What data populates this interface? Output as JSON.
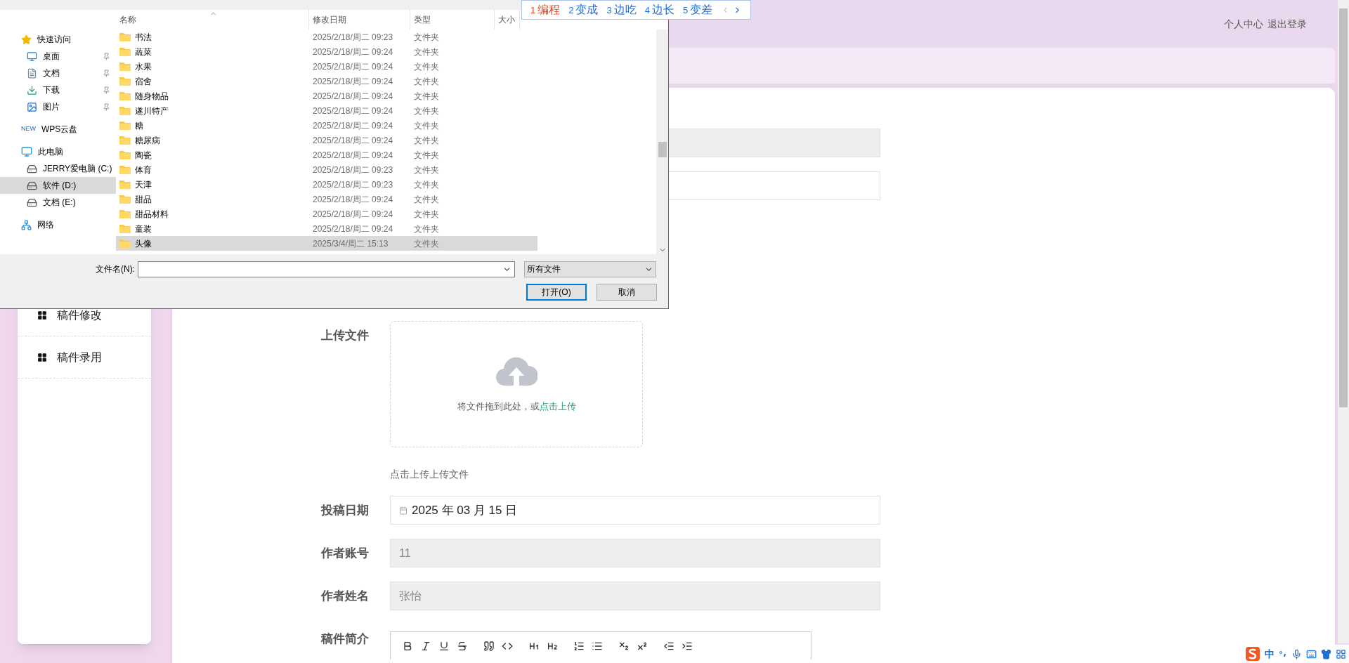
{
  "ime_candidates": [
    {
      "index": "1",
      "word": "编程",
      "selected": true
    },
    {
      "index": "2",
      "word": "变成",
      "selected": false
    },
    {
      "index": "3",
      "word": "边吃",
      "selected": false
    },
    {
      "index": "4",
      "word": "边长",
      "selected": false
    },
    {
      "index": "5",
      "word": "变差",
      "selected": false
    }
  ],
  "header": {
    "links": [
      "个人中心",
      "退出登录"
    ]
  },
  "sidebar": {
    "items": [
      {
        "label": "稿件修改"
      },
      {
        "label": "稿件录用"
      }
    ]
  },
  "form": {
    "fields": [
      {
        "kind": "readonly"
      },
      {
        "kind": "text"
      },
      {
        "kind": "upload",
        "label": "上传文件",
        "prompt": "将文件拖到此处，或",
        "link": "点击上传",
        "hint": "点击上传上传文件"
      },
      {
        "kind": "date",
        "label": "投稿日期",
        "value": "2025 年 03 月 15 日"
      },
      {
        "kind": "readonly",
        "label": "作者账号",
        "value": "11"
      },
      {
        "kind": "readonly",
        "label": "作者姓名",
        "value": "张怡"
      },
      {
        "kind": "editor",
        "label": "稿件简介"
      }
    ]
  },
  "file_dialog": {
    "nav": [
      {
        "label": "快速访问",
        "kind": "star",
        "selected": false,
        "children": [
          {
            "label": "桌面",
            "kind": "desktop",
            "pinned": true,
            "selected": false
          },
          {
            "label": "文档",
            "kind": "document",
            "pinned": true,
            "selected": false
          },
          {
            "label": "下载",
            "kind": "download",
            "pinned": true,
            "selected": false
          },
          {
            "label": "图片",
            "kind": "picture",
            "pinned": true,
            "selected": false
          }
        ]
      },
      {
        "label": "WPS云盘",
        "badge": "NEW",
        "kind": "cloud",
        "selected": false
      },
      {
        "label": "此电脑",
        "kind": "computer",
        "selected": false,
        "children": [
          {
            "label": "JERRY爱电脑 (C:)",
            "kind": "system-drive",
            "pinned": false,
            "selected": false
          },
          {
            "label": "软件 (D:)",
            "kind": "drive",
            "pinned": false,
            "selected": true
          },
          {
            "label": "文档 (E:)",
            "kind": "drive",
            "pinned": false,
            "selected": false
          }
        ]
      },
      {
        "label": "网络",
        "kind": "network",
        "selected": false
      }
    ],
    "columns": [
      "名称",
      "修改日期",
      "类型",
      "大小"
    ],
    "rows": [
      {
        "name": "书法",
        "modified": "2025/2/18/周二 09:23",
        "type": "文件夹",
        "selected": false
      },
      {
        "name": "蔬菜",
        "modified": "2025/2/18/周二 09:24",
        "type": "文件夹",
        "selected": false
      },
      {
        "name": "水果",
        "modified": "2025/2/18/周二 09:24",
        "type": "文件夹",
        "selected": false
      },
      {
        "name": "宿舍",
        "modified": "2025/2/18/周二 09:24",
        "type": "文件夹",
        "selected": false
      },
      {
        "name": "随身物品",
        "modified": "2025/2/18/周二 09:24",
        "type": "文件夹",
        "selected": false
      },
      {
        "name": "遂川特产",
        "modified": "2025/2/18/周二 09:24",
        "type": "文件夹",
        "selected": false
      },
      {
        "name": "糖",
        "modified": "2025/2/18/周二 09:24",
        "type": "文件夹",
        "selected": false
      },
      {
        "name": "糖尿病",
        "modified": "2025/2/18/周二 09:24",
        "type": "文件夹",
        "selected": false
      },
      {
        "name": "陶瓷",
        "modified": "2025/2/18/周二 09:24",
        "type": "文件夹",
        "selected": false
      },
      {
        "name": "体育",
        "modified": "2025/2/18/周二 09:23",
        "type": "文件夹",
        "selected": false
      },
      {
        "name": "天津",
        "modified": "2025/2/18/周二 09:23",
        "type": "文件夹",
        "selected": false
      },
      {
        "name": "甜品",
        "modified": "2025/2/18/周二 09:24",
        "type": "文件夹",
        "selected": false
      },
      {
        "name": "甜品材料",
        "modified": "2025/2/18/周二 09:24",
        "type": "文件夹",
        "selected": false
      },
      {
        "name": "童装",
        "modified": "2025/2/18/周二 09:24",
        "type": "文件夹",
        "selected": false
      },
      {
        "name": "头像",
        "modified": "2025/3/4/周二 15:13",
        "type": "文件夹",
        "selected": true
      }
    ],
    "filename_label": "文件名(N):",
    "filter": "所有文件",
    "buttons": [
      {
        "label": "打开(O)",
        "default": true
      },
      {
        "label": "取消",
        "default": false
      }
    ]
  },
  "ime_status": {
    "mode": "中"
  }
}
